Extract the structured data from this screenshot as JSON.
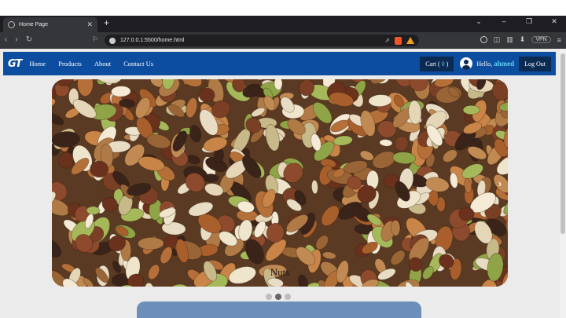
{
  "browser": {
    "tab_title": "Home Page",
    "url": "127.0.0.1:5500/home.html",
    "vpn_label": "VPN",
    "icons": [
      "globe-icon",
      "close-icon",
      "plus-icon",
      "back-icon",
      "forward-icon",
      "reload-icon",
      "bookmark-icon",
      "share-icon",
      "brave-icon",
      "rewards-icon",
      "menu-icon"
    ]
  },
  "navbar": {
    "logo": "GT",
    "links": [
      "Home",
      "Products",
      "About",
      "Contact Us"
    ],
    "cart_label": "Cart (",
    "cart_count": "0",
    "cart_close": ")",
    "greeting": "Hello,",
    "username": "ahmed",
    "logout_label": "Log Out",
    "colors": {
      "bar": "#0d4da0",
      "button": "#0b2a52",
      "accent": "#5dd0f0"
    }
  },
  "carousel": {
    "caption": "Nuts",
    "slide_count": 3,
    "active_slide": 2,
    "next_icon": "chevron-right-icon"
  }
}
